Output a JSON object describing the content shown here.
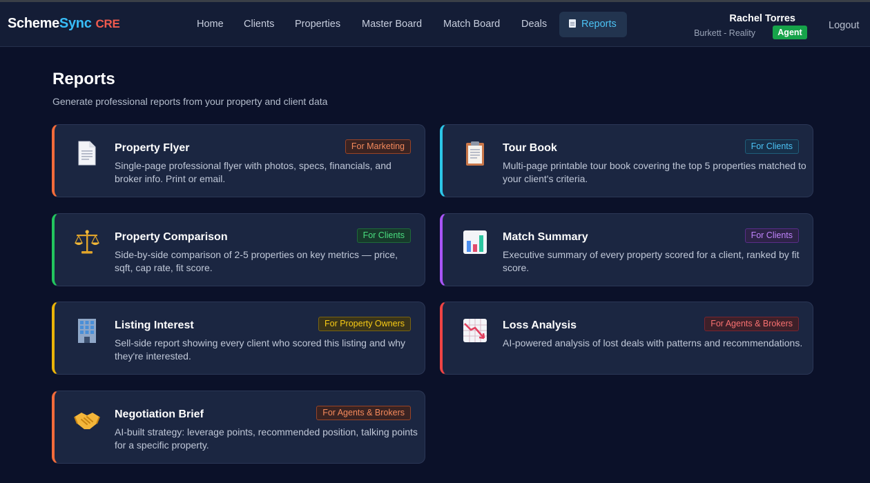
{
  "app": {
    "brand_part1": "Scheme",
    "brand_part2": "Sync",
    "brand_part3": "CRE"
  },
  "nav": {
    "items": [
      "Home",
      "Clients",
      "Properties",
      "Master Board",
      "Match Board",
      "Deals"
    ],
    "active_label": "Reports",
    "active_icon": "document-icon"
  },
  "user": {
    "name": "Rachel Torres",
    "org": "Burkett - Reality",
    "role": "Agent",
    "logout_label": "Logout"
  },
  "page": {
    "title": "Reports",
    "subtitle": "Generate professional reports from your property and client data"
  },
  "reports": [
    {
      "title": "Property Flyer",
      "badge": "For Marketing",
      "desc": "Single-page professional flyer with photos, specs, financials, and broker info. Print or email.",
      "icon": "page-icon",
      "accent": "#f26b3a"
    },
    {
      "title": "Tour Book",
      "badge": "For Clients",
      "desc": "Multi-page printable tour book covering the top 5 properties matched to your client's criteria.",
      "icon": "clipboard-icon",
      "accent": "#2cc6e8"
    },
    {
      "title": "Property Comparison",
      "badge": "For Clients",
      "desc": "Side-by-side comparison of 2-5 properties on key metrics — price, sqft, cap rate, fit score.",
      "icon": "scales-icon",
      "accent": "#22c55e"
    },
    {
      "title": "Match Summary",
      "badge": "For Clients",
      "desc": "Executive summary of every property scored for a client, ranked by fit score.",
      "icon": "bar-chart-icon",
      "accent": "#a855f7"
    },
    {
      "title": "Listing Interest",
      "badge": "For Property Owners",
      "desc": "Sell-side report showing every client who scored this listing and why they're interested.",
      "icon": "building-icon",
      "accent": "#eab308"
    },
    {
      "title": "Loss Analysis",
      "badge": "For Agents & Brokers",
      "desc": "AI-powered analysis of lost deals with patterns and recommendations.",
      "icon": "trend-down-icon",
      "accent": "#ef4444"
    },
    {
      "title": "Negotiation Brief",
      "badge": "For Agents & Brokers",
      "desc": "AI-built strategy: leverage points, recommended position, talking points for a specific property.",
      "icon": "handshake-icon",
      "accent": "#f26b3a"
    }
  ],
  "badge_colors": {
    "marketing": "#f26b3a",
    "clients_blue": "#38bdf8",
    "clients_green": "#4ade80",
    "clients_purple": "#c084fc",
    "owners": "#facc15",
    "agents": "#f87171"
  }
}
